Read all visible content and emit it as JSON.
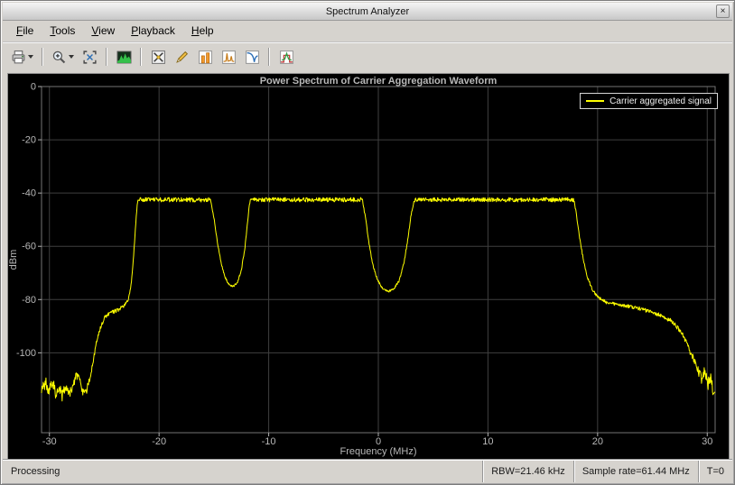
{
  "window": {
    "title": "Spectrum Analyzer",
    "close_glyph": "×"
  },
  "menu": {
    "items": [
      {
        "label": "File"
      },
      {
        "label": "Tools"
      },
      {
        "label": "View"
      },
      {
        "label": "Playback"
      },
      {
        "label": "Help"
      }
    ]
  },
  "toolbar": {
    "groups": [
      {
        "buttons": [
          {
            "name": "print-button",
            "icon": "printer-icon",
            "dropdown": true
          }
        ]
      },
      {
        "buttons": [
          {
            "name": "zoom-in-button",
            "icon": "zoom-in-icon",
            "dropdown": true
          },
          {
            "name": "fit-to-view-button",
            "icon": "fit-to-view-icon",
            "dropdown": false
          }
        ]
      },
      {
        "buttons": [
          {
            "name": "spectrum-settings-button",
            "icon": "spectrum-icon",
            "dropdown": false
          }
        ]
      },
      {
        "buttons": [
          {
            "name": "cursor-measurements-button",
            "icon": "cursor-measurements-icon",
            "dropdown": false
          },
          {
            "name": "peak-finder-button",
            "icon": "peak-finder-icon",
            "dropdown": false
          },
          {
            "name": "channel-measurements-button",
            "icon": "channel-measurements-icon",
            "dropdown": false
          },
          {
            "name": "distortion-measurements-button",
            "icon": "distortion-measurements-icon",
            "dropdown": false
          },
          {
            "name": "ccdf-measurements-button",
            "icon": "ccdf-measurements-icon",
            "dropdown": false
          }
        ]
      },
      {
        "buttons": [
          {
            "name": "spectral-mask-button",
            "icon": "spectral-mask-icon",
            "dropdown": false
          }
        ]
      }
    ]
  },
  "chart_data": {
    "type": "line",
    "title": "Power Spectrum of Carrier Aggregation Waveform",
    "xlabel": "Frequency (MHz)",
    "ylabel": "dBm",
    "xlim": [
      -30.72,
      30.72
    ],
    "ylim": [
      -130,
      0
    ],
    "xticks": [
      -30,
      -20,
      -10,
      0,
      10,
      20,
      30
    ],
    "yticks": [
      0,
      -20,
      -40,
      -60,
      -80,
      -100
    ],
    "grid": true,
    "background": "#000000",
    "grid_color": "#3f3f3f",
    "legend": {
      "position": "top-right",
      "entries": [
        {
          "label": "Carrier aggregated signal",
          "color": "#ffff00"
        }
      ]
    },
    "series": [
      {
        "name": "Carrier aggregated signal",
        "color": "#ffff00",
        "plateau_level_dbm": -42.5,
        "noise_floor_dbm": -114,
        "breakpoints": [
          [
            -30.72,
            -114,
            2.2
          ],
          [
            -30.35,
            -111,
            2.2
          ],
          [
            -30.05,
            -116,
            2.2
          ],
          [
            -29.75,
            -110,
            2.2
          ],
          [
            -29.45,
            -115,
            2.2
          ],
          [
            -29.15,
            -113,
            2.2
          ],
          [
            -28.85,
            -116,
            2.2
          ],
          [
            -28.45,
            -112,
            2.2
          ],
          [
            -28.1,
            -115,
            2.2
          ],
          [
            -27.75,
            -111,
            2.0
          ],
          [
            -27.45,
            -108,
            1.8
          ],
          [
            -27.15,
            -112,
            2.0
          ],
          [
            -26.9,
            -115,
            2.2
          ],
          [
            -26.6,
            -113.5,
            2.0
          ],
          [
            -26.3,
            -110,
            1.2
          ],
          [
            -26.0,
            -103,
            0.9
          ],
          [
            -25.7,
            -96,
            0.8
          ],
          [
            -25.35,
            -90.5,
            0.7
          ],
          [
            -25.0,
            -87,
            0.7
          ],
          [
            -24.5,
            -85,
            0.7
          ],
          [
            -23.8,
            -84,
            0.7
          ],
          [
            -23.2,
            -82.5,
            0.7
          ],
          [
            -22.8,
            -80,
            0.6
          ],
          [
            -22.5,
            -73,
            0.5
          ],
          [
            -22.3,
            -62,
            0.45
          ],
          [
            -22.1,
            -50,
            0.45
          ],
          [
            -21.95,
            -42.5,
            0.8
          ],
          [
            -15.35,
            -42.5,
            0.85
          ],
          [
            -15.0,
            -49,
            0.5
          ],
          [
            -14.7,
            -58,
            0.45
          ],
          [
            -14.35,
            -66,
            0.4
          ],
          [
            -14.0,
            -71.5,
            0.4
          ],
          [
            -13.6,
            -74.5,
            0.35
          ],
          [
            -13.2,
            -75,
            0.35
          ],
          [
            -12.85,
            -73.5,
            0.35
          ],
          [
            -12.5,
            -69,
            0.4
          ],
          [
            -12.15,
            -60,
            0.45
          ],
          [
            -11.9,
            -50,
            0.5
          ],
          [
            -11.7,
            -42.5,
            0.8
          ],
          [
            -1.45,
            -42.5,
            0.85
          ],
          [
            -1.15,
            -50,
            0.5
          ],
          [
            -0.85,
            -59,
            0.45
          ],
          [
            -0.5,
            -67,
            0.4
          ],
          [
            -0.1,
            -72.5,
            0.4
          ],
          [
            0.4,
            -76,
            0.35
          ],
          [
            0.9,
            -77,
            0.35
          ],
          [
            1.4,
            -76,
            0.35
          ],
          [
            1.9,
            -73,
            0.4
          ],
          [
            2.35,
            -66,
            0.4
          ],
          [
            2.7,
            -57,
            0.45
          ],
          [
            3.0,
            -48,
            0.5
          ],
          [
            3.25,
            -42.5,
            0.8
          ],
          [
            17.85,
            -42.5,
            0.85
          ],
          [
            18.1,
            -49,
            0.5
          ],
          [
            18.4,
            -58,
            0.5
          ],
          [
            18.75,
            -66,
            0.5
          ],
          [
            19.1,
            -72,
            0.5
          ],
          [
            19.5,
            -76,
            0.5
          ],
          [
            20.0,
            -79,
            0.55
          ],
          [
            20.8,
            -81,
            0.6
          ],
          [
            22.0,
            -82,
            0.6
          ],
          [
            23.5,
            -83,
            0.65
          ],
          [
            24.8,
            -84.5,
            0.7
          ],
          [
            25.8,
            -86,
            0.75
          ],
          [
            26.7,
            -88,
            0.8
          ],
          [
            27.4,
            -91,
            0.9
          ],
          [
            28.0,
            -95,
            1.0
          ],
          [
            28.5,
            -100,
            1.3
          ],
          [
            28.9,
            -104,
            1.6
          ],
          [
            29.2,
            -107,
            1.9
          ],
          [
            29.5,
            -110,
            2.1
          ],
          [
            29.75,
            -106,
            2.1
          ],
          [
            30.05,
            -112,
            2.2
          ],
          [
            30.3,
            -109,
            2.2
          ],
          [
            30.5,
            -114,
            2.2
          ],
          [
            30.72,
            -113,
            2.2
          ]
        ]
      }
    ]
  },
  "status_bar": {
    "left": "Processing",
    "cells": [
      {
        "label": "RBW=21.46 kHz"
      },
      {
        "label": "Sample rate=61.44 MHz"
      },
      {
        "label": "T=0"
      }
    ]
  }
}
